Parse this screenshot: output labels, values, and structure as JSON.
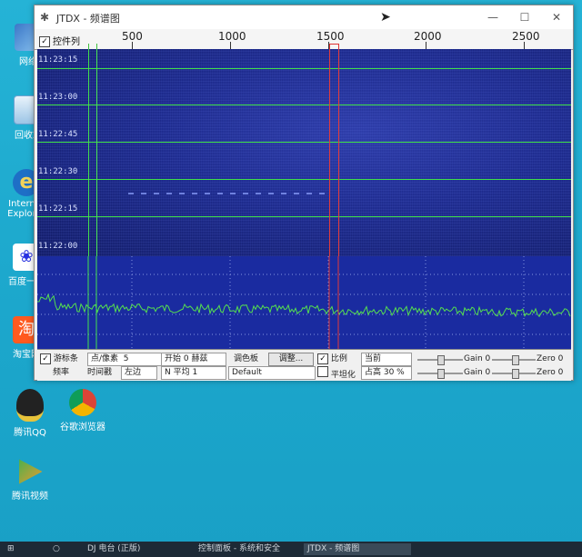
{
  "desktop": {
    "icons": [
      {
        "label": "网络"
      },
      {
        "label": "回收站"
      },
      {
        "label": "Internet Explorer"
      },
      {
        "label": "百度一下"
      },
      {
        "label": "淘宝网"
      },
      {
        "label": "腾讯QQ"
      },
      {
        "label": "谷歌浏览器"
      },
      {
        "label": "腾讯视频"
      }
    ]
  },
  "window": {
    "title": "JTDX - 频谱图",
    "controls": {
      "minimize": "—",
      "maximize": "☐",
      "close": "✕"
    }
  },
  "ruler": {
    "control_label": "控件列",
    "ticks": [
      "500",
      "1000",
      "1500",
      "2000",
      "2500"
    ]
  },
  "waterfall": {
    "time_labels": [
      "11:23:15",
      "11:23:00",
      "11:22:45",
      "11:22:30",
      "11:22:15",
      "11:22:00"
    ]
  },
  "controls": {
    "row1": {
      "cursor_label": "游标条",
      "pixels_label": "点/像素",
      "pixels_value": "5",
      "start_label": "开始 0 赫兹",
      "palette_label": "调色板",
      "adjust_button": "调整...",
      "ratio_label": "比例",
      "mode_value": "当前",
      "gain_label": "Gain 0",
      "zero_label": "Zero 0"
    },
    "row2": {
      "freq_label": "频率",
      "timestamp_label": "时间戳",
      "side_value": "左边",
      "avg_label": "N 平均 1",
      "palette_value": "Default",
      "smooth_label": "平坦化",
      "height_value": "占高 30 %",
      "gain_label": "Gain 0",
      "zero_label": "Zero 0"
    }
  },
  "taskbar": {
    "items": [
      "DJ 电台 (正版)",
      "控制面板 - 系统和安全",
      "JTDX - 频谱图",
      ""
    ]
  },
  "colors": {
    "desktop": "#1ea9cc",
    "waterfall": "#1d2a8c",
    "spectrum": "#1a2ba0",
    "trace": "#55e04e",
    "marker_green": "#44e04e",
    "marker_red": "#e13a3a"
  }
}
